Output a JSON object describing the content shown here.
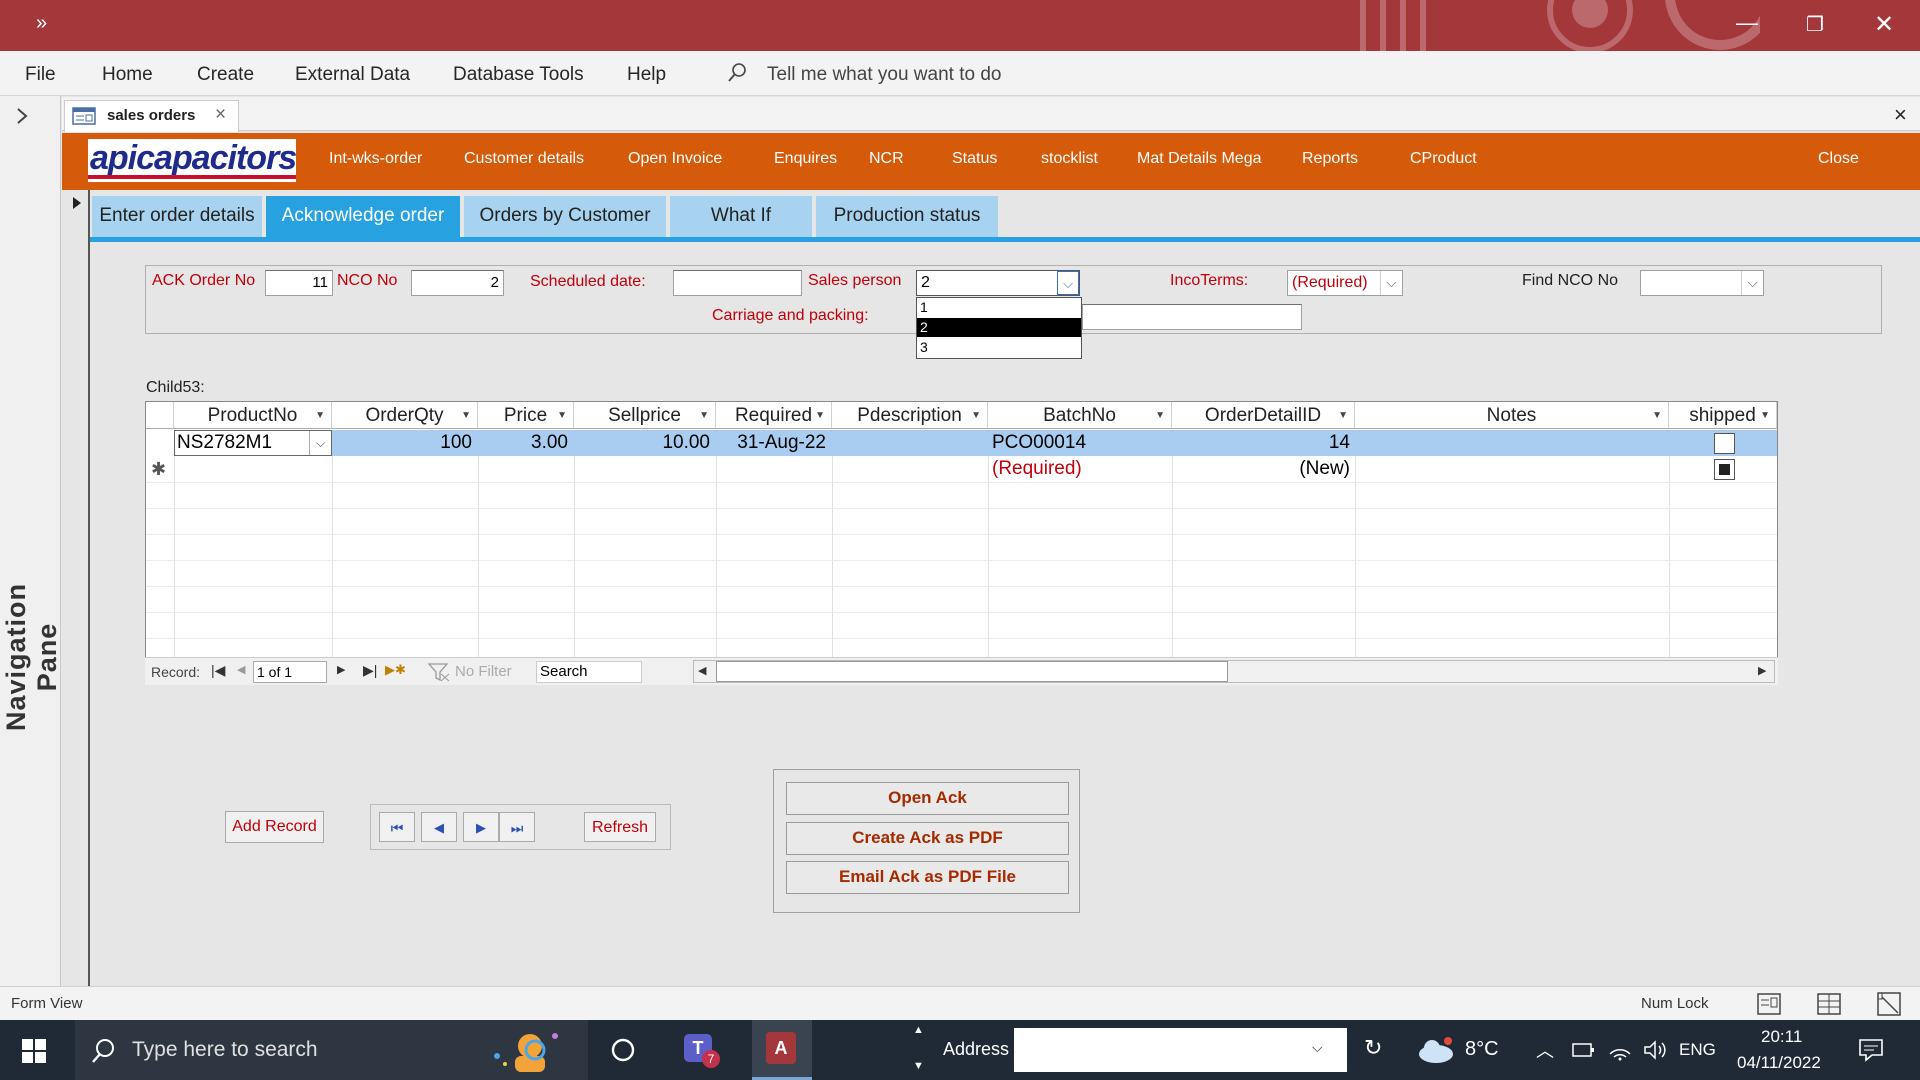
{
  "window": {
    "minimize_glyph": "—",
    "restore_glyph": "❐",
    "close_glyph": "✕",
    "quick_access": "»"
  },
  "menu": {
    "items": [
      "File",
      "Home",
      "Create",
      "External Data",
      "Database Tools",
      "Help"
    ],
    "search_placeholder": "Tell me what you want to do"
  },
  "nav_pane": {
    "label": "Navigation Pane"
  },
  "doc_tab": {
    "title": "sales orders",
    "close": "×"
  },
  "doc_close": "×",
  "orange_bar": {
    "logo": "apicapacitors",
    "buttons": [
      "Int-wks-order",
      "Customer details",
      "Open Invoice",
      "Enquires",
      "NCR",
      "Status",
      "stocklist",
      "Mat Details Mega",
      "Reports",
      "CProduct"
    ],
    "close": "Close"
  },
  "tabs": [
    "Enter order details",
    "Acknowledge order",
    "Orders by Customer",
    "What If",
    "Production status"
  ],
  "active_tab": "Acknowledge order",
  "header": {
    "ack_order_no_label": "ACK Order No",
    "ack_order_no": "11",
    "nco_no_label": "NCO No",
    "nco_no": "2",
    "scheduled_date_label": "Scheduled date:",
    "scheduled_date": "",
    "sales_person_label": "Sales person",
    "sales_person": "2",
    "sales_person_options": [
      "1",
      "2",
      "3"
    ],
    "sales_person_selected": "2",
    "incoterms_label": "IncoTerms:",
    "incoterms": "(Required)",
    "find_nco_label": "Find NCO No",
    "find_nco": "",
    "carriage_label": "Carriage  and packing:"
  },
  "subform": {
    "label": "Child53:",
    "columns": [
      "ProductNo",
      "OrderQty",
      "Price",
      "Sellprice",
      "Required",
      "Pdescription",
      "BatchNo",
      "OrderDetailID",
      "Notes",
      "shipped"
    ],
    "rows": [
      {
        "ProductNo": "NS2782M1",
        "OrderQty": "100",
        "Price": "3.00",
        "Sellprice": "10.00",
        "Required": "31-Aug-22",
        "Pdescription": "",
        "BatchNo": "PCO00014",
        "OrderDetailID": "14",
        "Notes": "",
        "shipped": false
      }
    ],
    "new_row": {
      "marker": "✱",
      "BatchNo": "(Required)",
      "OrderDetailID": "(New)"
    },
    "record_nav": {
      "label": "Record:",
      "position": "1 of 1",
      "filter": "No Filter",
      "search": "Search"
    }
  },
  "buttons": {
    "add_record": "Add Record",
    "refresh": "Refresh",
    "open_ack": "Open Ack",
    "create_pdf": "Create Ack as PDF",
    "email_pdf": "Email Ack as PDF File"
  },
  "status_bar": {
    "view": "Form View",
    "num_lock": "Num Lock"
  },
  "taskbar": {
    "search_placeholder": "Type here to search",
    "address_label": "Address",
    "weather": "8°C",
    "language": "ENG",
    "time": "20:11",
    "date": "04/11/2022"
  },
  "colors": {
    "title_bar": "#a4373a",
    "orange_bar": "#d55b0a",
    "tab_active": "#27a1e0",
    "tab_inactive": "#a8d3f0",
    "label_red": "#c0000b"
  }
}
